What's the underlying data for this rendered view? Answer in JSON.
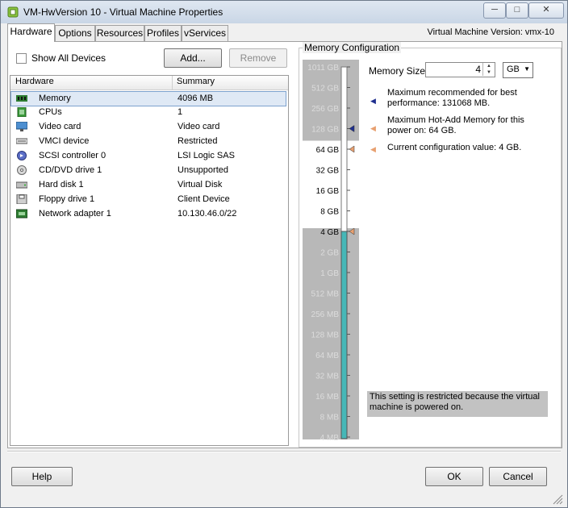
{
  "window": {
    "title": "VM-HwVersion 10 - Virtual Machine Properties",
    "controls": [
      "─",
      "□",
      "✕"
    ]
  },
  "tabs": [
    "Hardware",
    "Options",
    "Resources",
    "Profiles",
    "vServices"
  ],
  "vm_version": "Virtual Machine Version: vmx-10",
  "toolbar": {
    "show_all_devices": "Show All Devices",
    "add": "Add...",
    "remove": "Remove"
  },
  "hardware_list": {
    "headers": [
      "Hardware",
      "Summary"
    ],
    "rows": [
      {
        "name": "Memory",
        "summary": "4096 MB",
        "icon": "memory-icon"
      },
      {
        "name": "CPUs",
        "summary": "1",
        "icon": "cpu-icon"
      },
      {
        "name": "Video card",
        "summary": "Video card",
        "icon": "monitor-icon"
      },
      {
        "name": "VMCI device",
        "summary": "Restricted",
        "icon": "vmci-icon"
      },
      {
        "name": "SCSI controller 0",
        "summary": "LSI Logic SAS",
        "icon": "scsi-icon"
      },
      {
        "name": "CD/DVD drive 1",
        "summary": "Unsupported",
        "icon": "cd-icon"
      },
      {
        "name": "Hard disk 1",
        "summary": "Virtual Disk",
        "icon": "disk-icon"
      },
      {
        "name": "Floppy drive 1",
        "summary": "Client Device",
        "icon": "floppy-icon"
      },
      {
        "name": "Network adapter 1",
        "summary": "10.130.46.0/22",
        "icon": "network-icon"
      }
    ]
  },
  "memory_config": {
    "title": "Memory Configuration",
    "size_label": "Memory Size:",
    "size_value": "4",
    "unit": "GB",
    "scale": [
      "1011 GB",
      "512 GB",
      "256 GB",
      "128 GB",
      "64 GB",
      "32 GB",
      "16 GB",
      "8 GB",
      "4 GB",
      "2 GB",
      "1 GB",
      "512 MB",
      "256 MB",
      "128 MB",
      "64 MB",
      "32 MB",
      "16 MB",
      "8 MB",
      "4 MB"
    ],
    "legend": [
      {
        "text": "Maximum recommended for best performance: 131068 MB.",
        "color": "#1f2f8f"
      },
      {
        "text": "Maximum Hot-Add Memory for this power on: 64 GB.",
        "color": "#e8a070"
      },
      {
        "text": "Current configuration value: 4 GB.",
        "color": "#e8a070"
      }
    ],
    "restricted_note": "This setting is restricted because the virtual machine is powered on."
  },
  "footer": {
    "help": "Help",
    "ok": "OK",
    "cancel": "Cancel"
  }
}
